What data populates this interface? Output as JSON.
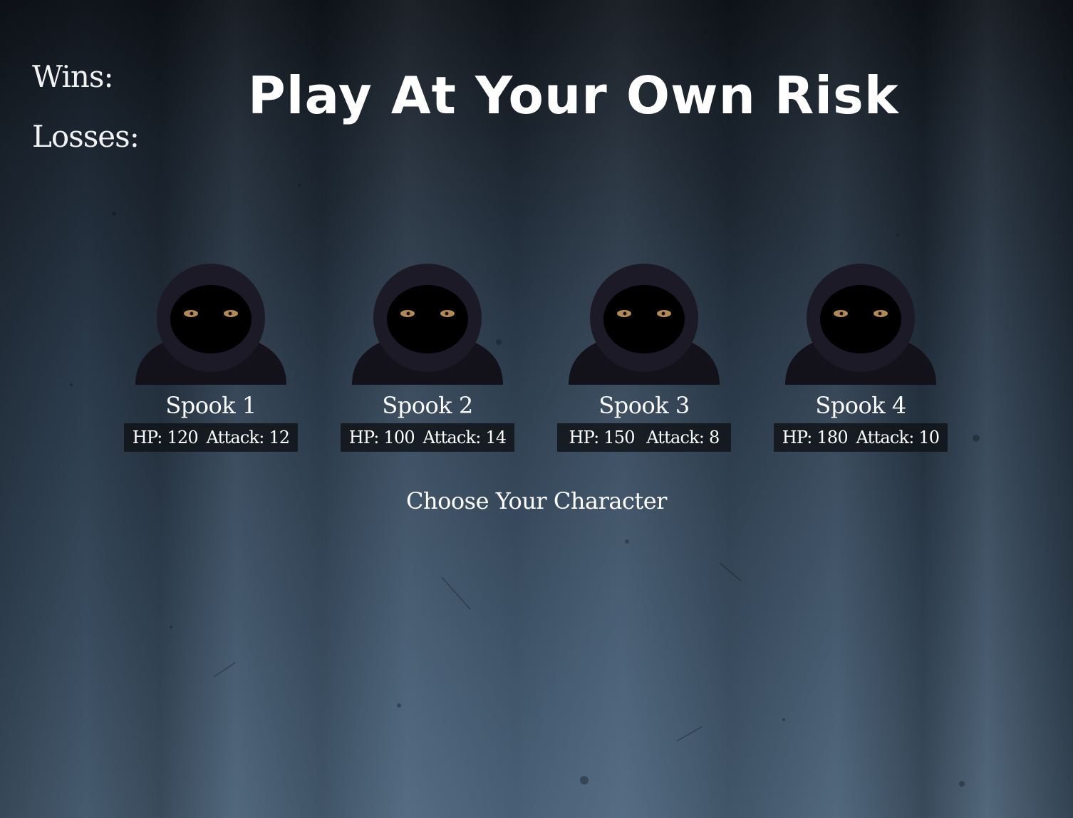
{
  "scoreboard": {
    "wins_label": "Wins:",
    "losses_label": "Losses:"
  },
  "title": "Play At Your Own Risk",
  "characters": [
    {
      "name": "Spook 1",
      "hp": "HP: 120",
      "attack": "Attack: 12",
      "icon": "hooded-figure-icon"
    },
    {
      "name": "Spook 2",
      "hp": "HP: 100",
      "attack": "Attack: 14",
      "icon": "hooded-figure-icon"
    },
    {
      "name": "Spook 3",
      "hp": "HP: 150",
      "attack": "Attack: 8",
      "icon": "hooded-figure-icon"
    },
    {
      "name": "Spook 4",
      "hp": "HP: 180",
      "attack": "Attack: 10",
      "icon": "hooded-figure-icon"
    }
  ],
  "prompt": "Choose Your Character",
  "colors": {
    "hood": "#1c1a26",
    "face": "#000000",
    "eyes": "#b08a52",
    "stats_bg": "#0f1216"
  }
}
